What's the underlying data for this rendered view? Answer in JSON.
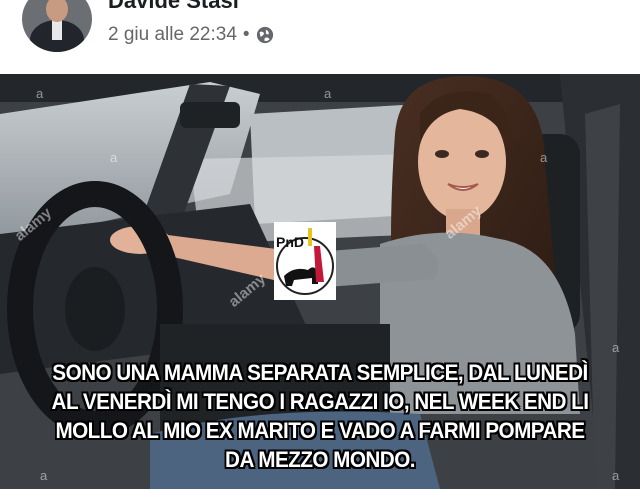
{
  "post": {
    "author": "Davide Stasi",
    "date": "2 giu alle 22:34",
    "separator": "•",
    "privacy_icon": "globe-icon"
  },
  "image": {
    "logo_text": "PnD",
    "watermark": "alamy",
    "watermark_small": "a",
    "caption_lines": [
      "SONO UNA MAMMA SEPARATA SEMPLICE, DAL LUNEDÌ",
      "AL VENERDÌ MI TENGO I RAGAZZI IO, NEL WEEK END LI",
      "MOLLO AL MIO EX MARITO E VADO A FARMI POMPARE",
      "DA MEZZO MONDO."
    ]
  }
}
